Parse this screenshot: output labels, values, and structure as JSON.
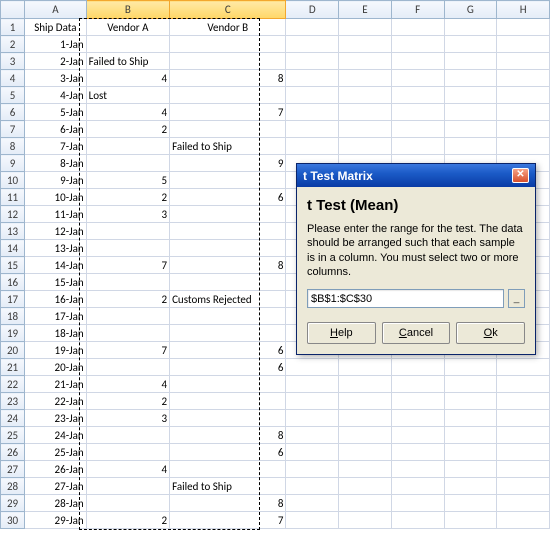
{
  "columns": [
    "A",
    "B",
    "C",
    "D",
    "E",
    "F",
    "G",
    "H"
  ],
  "selectedCols": [
    "B",
    "C"
  ],
  "headers": {
    "A": "Ship Data",
    "B": "Vendor A",
    "C": "Vendor B"
  },
  "rows": [
    {
      "n": 1,
      "A": "Ship Data",
      "B": "Vendor A",
      "C": "Vendor B"
    },
    {
      "n": 2,
      "A": "1-Jan",
      "B": "",
      "C": ""
    },
    {
      "n": 3,
      "A": "2-Jan",
      "B": "Failed to Ship",
      "C": ""
    },
    {
      "n": 4,
      "A": "3-Jan",
      "B": "4",
      "C": "8"
    },
    {
      "n": 5,
      "A": "4-Jan",
      "B": "Lost",
      "C": ""
    },
    {
      "n": 6,
      "A": "5-Jan",
      "B": "4",
      "C": "7"
    },
    {
      "n": 7,
      "A": "6-Jan",
      "B": "2",
      "C": ""
    },
    {
      "n": 8,
      "A": "7-Jan",
      "B": "",
      "C": "Failed to Ship"
    },
    {
      "n": 9,
      "A": "8-Jan",
      "B": "",
      "C": "9"
    },
    {
      "n": 10,
      "A": "9-Jan",
      "B": "5",
      "C": ""
    },
    {
      "n": 11,
      "A": "10-Jan",
      "B": "2",
      "C": "6"
    },
    {
      "n": 12,
      "A": "11-Jan",
      "B": "3",
      "C": ""
    },
    {
      "n": 13,
      "A": "12-Jan",
      "B": "",
      "C": ""
    },
    {
      "n": 14,
      "A": "13-Jan",
      "B": "",
      "C": ""
    },
    {
      "n": 15,
      "A": "14-Jan",
      "B": "7",
      "C": "8"
    },
    {
      "n": 16,
      "A": "15-Jan",
      "B": "",
      "C": ""
    },
    {
      "n": 17,
      "A": "16-Jan",
      "B": "2",
      "C": "Customs Rejected"
    },
    {
      "n": 18,
      "A": "17-Jan",
      "B": "",
      "C": ""
    },
    {
      "n": 19,
      "A": "18-Jan",
      "B": "",
      "C": ""
    },
    {
      "n": 20,
      "A": "19-Jan",
      "B": "7",
      "C": "6"
    },
    {
      "n": 21,
      "A": "20-Jan",
      "B": "",
      "C": "6"
    },
    {
      "n": 22,
      "A": "21-Jan",
      "B": "4",
      "C": ""
    },
    {
      "n": 23,
      "A": "22-Jan",
      "B": "2",
      "C": ""
    },
    {
      "n": 24,
      "A": "23-Jan",
      "B": "3",
      "C": ""
    },
    {
      "n": 25,
      "A": "24-Jan",
      "B": "",
      "C": "8"
    },
    {
      "n": 26,
      "A": "25-Jan",
      "B": "",
      "C": "6"
    },
    {
      "n": 27,
      "A": "26-Jan",
      "B": "4",
      "C": ""
    },
    {
      "n": 28,
      "A": "27-Jan",
      "B": "",
      "C": "Failed to Ship"
    },
    {
      "n": 29,
      "A": "28-Jan",
      "B": "",
      "C": "8"
    },
    {
      "n": 30,
      "A": "29-Jan",
      "B": "2",
      "C": "7"
    }
  ],
  "dialog": {
    "title": "t Test Matrix",
    "heading": "t Test (Mean)",
    "desc": "Please enter the range for the test. The data should be arranged such that each sample is in a column. You must select two or more columns.",
    "input": "$B$1:$C$30",
    "buttons": {
      "help": "Help",
      "cancel": "Cancel",
      "ok": "Ok"
    }
  }
}
